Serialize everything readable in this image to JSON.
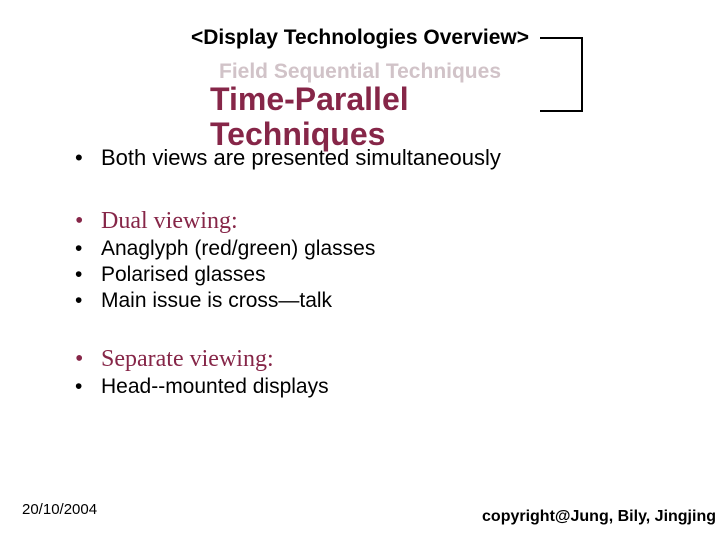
{
  "header": "<Display Technologies  Overview>",
  "subheader": "Field Sequential Techniques",
  "title_line1": "Time-Parallel",
  "title_line2": "Techniques",
  "bullets": {
    "intro": "Both views are presented simultaneously",
    "dual_heading": "Dual viewing:",
    "dual_items": [
      "Anaglyph (red/green) glasses",
      "Polarised glasses",
      "Main issue is cross—talk"
    ],
    "sep_heading": "Separate viewing:",
    "sep_items": [
      "Head--mounted displays"
    ]
  },
  "footer": {
    "date": "20/10/2004",
    "copyright": "copyright@Jung, Bily, Jingjing"
  }
}
